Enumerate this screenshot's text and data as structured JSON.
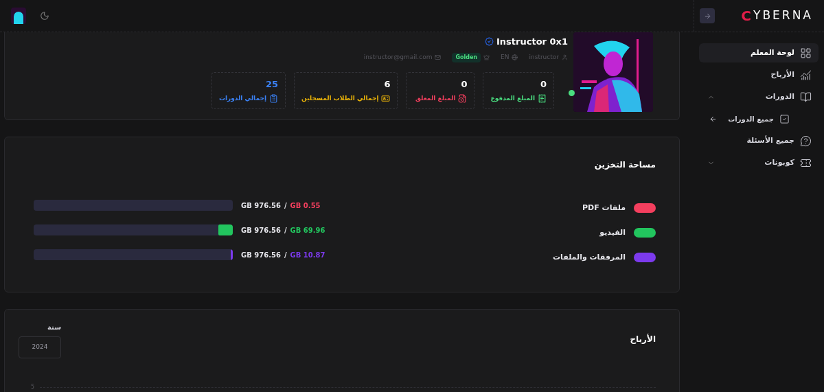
{
  "sidebar": {
    "logo": {
      "mark": "C",
      "text": "YBERNA"
    },
    "items": [
      {
        "label": "لوحة المعلم",
        "selected": true
      },
      {
        "label": "الأرباح",
        "selected": false
      },
      {
        "label": "الدورات",
        "selected": false,
        "expanded": true,
        "children": [
          {
            "label": "جميع الدورات",
            "selected": false
          }
        ]
      },
      {
        "label": "جميع الأسئلة",
        "selected": false
      },
      {
        "label": "كوبونات",
        "selected": false,
        "expanded": false
      }
    ]
  },
  "profile": {
    "name": "Instructor 0x1",
    "online": true,
    "meta": [
      {
        "text": "instructor",
        "kind": "text"
      },
      {
        "text": "EN",
        "kind": "text"
      },
      {
        "text": "Golden",
        "kind": "badge"
      },
      {
        "text": "instructor@gmail.com",
        "kind": "text"
      }
    ],
    "stats": [
      {
        "value": "0",
        "label": "المبلغ المدفوع",
        "color": "#4ade80"
      },
      {
        "value": "0",
        "label": "المبلغ المعلق",
        "color": "#f43f5e"
      },
      {
        "value": "6",
        "label": "إجمالي الطلاب المسجلين",
        "color": "#eab308"
      },
      {
        "value": "25",
        "label": "إجمالي الدورات",
        "color": "#3b82f6"
      }
    ]
  },
  "storage": {
    "title": "مساحة التخزين",
    "items": [
      {
        "label": "ملفات PDF",
        "color": "#f43f5e",
        "level": 0.0006,
        "total": "GB 976.56",
        "separator": "/",
        "used": "GB 0.55"
      },
      {
        "label": "الفيديو",
        "color": "#22c55e",
        "level": 0.0716,
        "total": "GB 976.56",
        "separator": "/",
        "used": "GB 69.96"
      },
      {
        "label": "المرفقات والملفات",
        "color": "#7c3aed",
        "level": 0.0111,
        "total": "GB 976.56",
        "separator": "/",
        "used": "GB 10.87"
      }
    ]
  },
  "earnings": {
    "title": "الأرباح",
    "year_label": "سنة",
    "year_value": "2024",
    "y_tick": "5"
  }
}
